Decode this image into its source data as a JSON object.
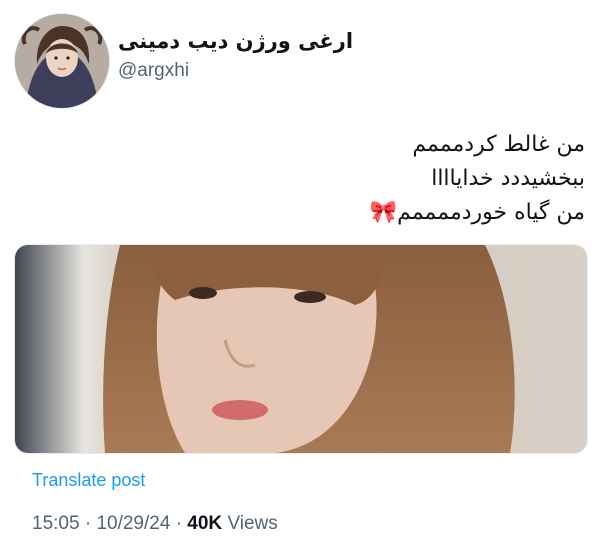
{
  "author": {
    "display_name": "ارغی ورژن دیب دمینی",
    "handle": "@argxhi"
  },
  "tweet": {
    "lines": [
      "من غالط کردمممم",
      "ببخشیددد خدایاااا",
      "من گیاه خوردممممم"
    ],
    "emoji": "🎀",
    "translate_label": "Translate post",
    "time": "15:05",
    "date": "10/29/24",
    "views_count": "40K",
    "views_label": "Views",
    "separator": "·"
  },
  "icons": {
    "avatar": "user-avatar-photo",
    "media": "attached-photo",
    "bow": "ribbon-emoji"
  }
}
